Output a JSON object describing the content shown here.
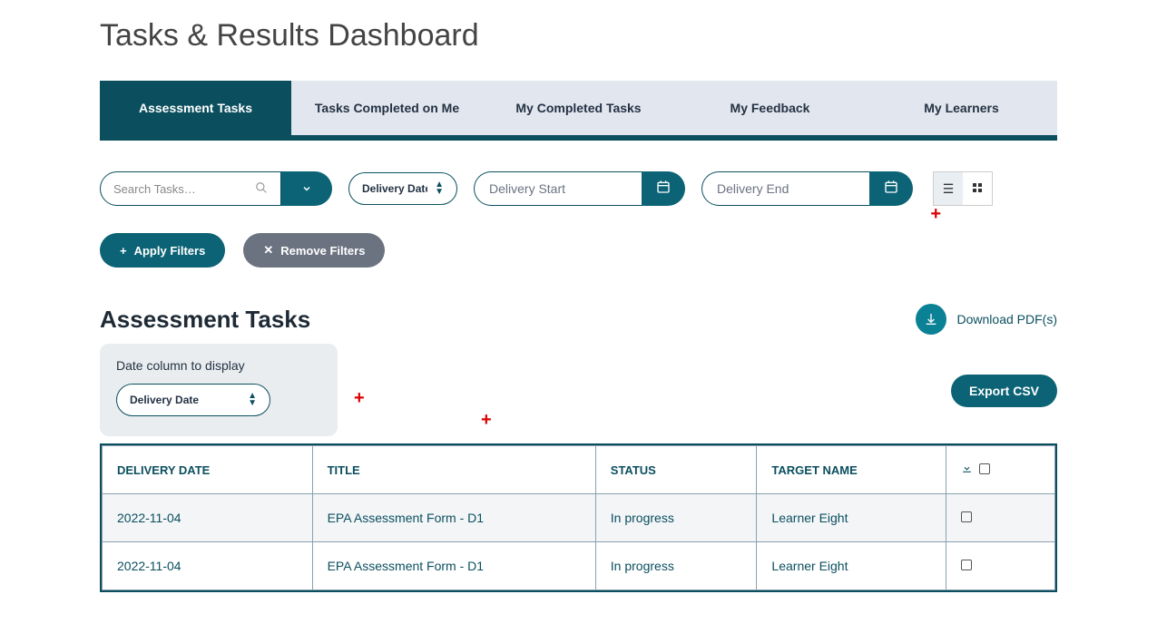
{
  "page_title": "Tasks & Results Dashboard",
  "tabs": [
    {
      "label": "Assessment Tasks",
      "active": true
    },
    {
      "label": "Tasks Completed on Me",
      "active": false
    },
    {
      "label": "My Completed Tasks",
      "active": false
    },
    {
      "label": "My Feedback",
      "active": false
    },
    {
      "label": "My Learners",
      "active": false
    }
  ],
  "filters": {
    "search_placeholder": "Search Tasks…",
    "date_field_select": "Delivery Date",
    "start_placeholder": "Delivery Start",
    "end_placeholder": "Delivery End",
    "apply_label": "Apply Filters",
    "remove_label": "Remove Filters"
  },
  "section_title": "Assessment Tasks",
  "download_pdfs_label": "Download PDF(s)",
  "export_csv_label": "Export CSV",
  "date_column": {
    "label": "Date column to display",
    "value": "Delivery Date"
  },
  "columns": {
    "delivery_date": "DELIVERY DATE",
    "title": "TITLE",
    "status": "STATUS",
    "target_name": "TARGET NAME"
  },
  "rows": [
    {
      "date": "2022-11-04",
      "title": "EPA Assessment Form - D1",
      "status": "In progress",
      "target": "Learner Eight"
    },
    {
      "date": "2022-11-04",
      "title": "EPA Assessment Form - D1",
      "status": "In progress",
      "target": "Learner Eight"
    }
  ],
  "annotation_markers": [
    "+",
    "+",
    "+"
  ]
}
